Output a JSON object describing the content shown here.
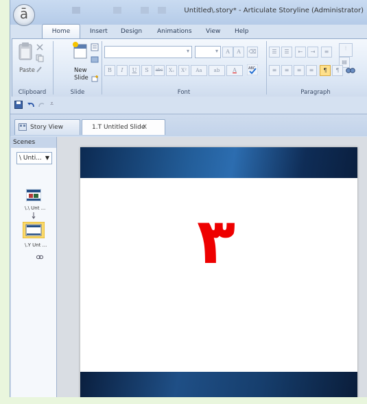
{
  "app": {
    "title": "Untitled\\.story* - Articulate Storyline (Administrator)",
    "app_button_glyph": "ā"
  },
  "ribbon_tabs": [
    {
      "label": "Home",
      "active": true
    },
    {
      "label": "Insert"
    },
    {
      "label": "Design"
    },
    {
      "label": "Animations"
    },
    {
      "label": "View"
    },
    {
      "label": "Help"
    }
  ],
  "ribbon": {
    "clipboard": {
      "paste_label": "Paste",
      "group_label": "Clipboard"
    },
    "slide": {
      "new_slide_label_line1": "New",
      "new_slide_label_line2": "Slide",
      "group_label": "Slide"
    },
    "font": {
      "group_label": "Font",
      "font_name_value": "",
      "font_size_value": "",
      "bold": "B",
      "italic": "I",
      "underline": "U",
      "shadow": "S",
      "strike": "abc",
      "subscript": "X₂",
      "superscript": "X²",
      "case": "Aa",
      "highlight": "ab",
      "font_color": "A"
    },
    "paragraph": {
      "group_label": "Paragraph"
    }
  },
  "document_tabs": [
    {
      "label": "Story View"
    },
    {
      "label": "1.T Untitled Slide",
      "close": "X",
      "active": true
    }
  ],
  "scenes": {
    "header": "Scenes",
    "selected_scene": "\\ Unti...",
    "slides": [
      {
        "label": "\\.\\ Unt ..."
      },
      {
        "label": "\\.Y Unt ..."
      }
    ]
  },
  "slide": {
    "main_text": "٣",
    "text_color": "#ee0000"
  },
  "icons": {
    "save": "save-icon",
    "undo": "undo-icon",
    "redo": "redo-icon",
    "link": "link-icon"
  }
}
